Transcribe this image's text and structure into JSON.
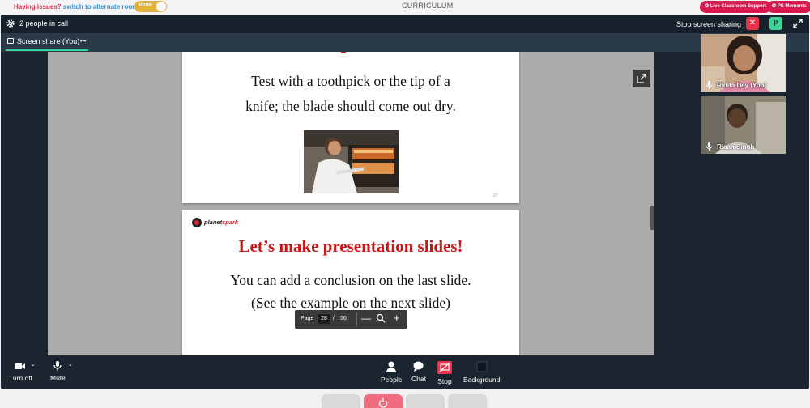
{
  "topbar": {
    "issues_warn": "Having issues?",
    "issues_link": "switch to alternate room",
    "room_toggle": "ROOM",
    "title": "CURRICULUM",
    "live_support": "Live Classroom Support",
    "ps_moments": "PS Moments"
  },
  "callbar": {
    "people_count": "2 people in call",
    "stop_sharing": "Stop screen sharing",
    "close": "✕",
    "user_initial": "P"
  },
  "tab": {
    "label": "Screen share (You)",
    "menu": "•••"
  },
  "slides": {
    "slide1_line1": "Test with a toothpick or the tip of a",
    "slide1_line2": "knife; the blade should come out dry.",
    "slide1_number": "27",
    "slide2_logo_a": "planet",
    "slide2_logo_b": "spark",
    "slide2_heading": "Let’s make presentation slides!",
    "slide2_line1": "You can add a conclusion on the last slide.",
    "slide2_line2": "(See the example on the next slide)"
  },
  "pager": {
    "label": "Page",
    "current": "28",
    "slash": "/",
    "total": "56",
    "minus": "—",
    "plus": "+"
  },
  "participants": [
    {
      "name": "Ridita Dey (You)"
    },
    {
      "name": "Riaan Singh"
    }
  ],
  "controls": {
    "turn_off": "Turn off",
    "mute": "Mute",
    "people": "People",
    "chat": "Chat",
    "stop": "Stop",
    "background": "Background",
    "caret": "⌄"
  },
  "colors": {
    "accent_green": "#3ed39b",
    "danger_red": "#e8334a",
    "brand_pink": "#d91a4f",
    "slide_heading_red": "#cc1717"
  }
}
